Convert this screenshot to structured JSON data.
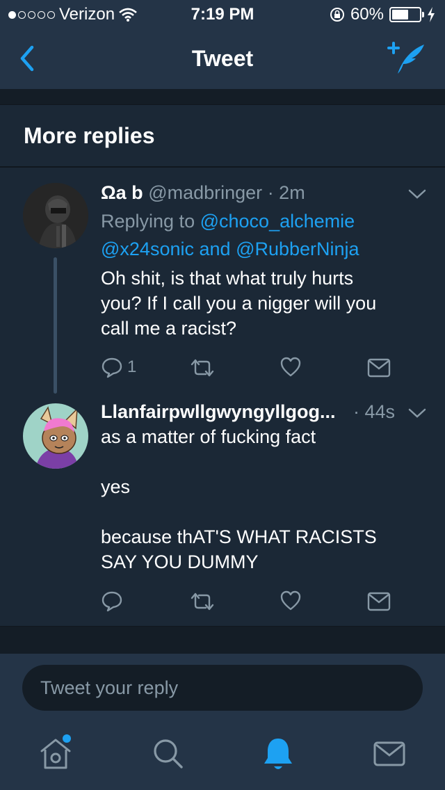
{
  "status_bar": {
    "carrier": "Verizon",
    "time": "7:19 PM",
    "battery": "60%",
    "battery_level": 0.6
  },
  "nav": {
    "title": "Tweet"
  },
  "section": {
    "title": "More replies"
  },
  "tweets": [
    {
      "display_name": "Ωa b",
      "handle": "@madbringer",
      "time": "· 2m",
      "replying_prefix": "Replying to",
      "replying_line1": "@choco_alchemie",
      "replying_mention2": "@x24sonic",
      "replying_and": "and",
      "replying_mention3": "@RubberNinja",
      "body_lines": [
        "Oh shit, is that what truly hurts",
        "you? If I call you a nigger will you",
        "call me a racist?"
      ],
      "reply_count": "1"
    },
    {
      "display_name": "Llanfairpwllgwyngyllgog...",
      "time": "· 44s",
      "body_lines": [
        "as a matter of fucking fact",
        "",
        "yes",
        "",
        "because thAT'S WHAT RACISTS",
        "SAY YOU DUMMY"
      ]
    }
  ],
  "reply_box": {
    "placeholder": "Tweet your reply"
  },
  "colors": {
    "accent": "#1da1f2",
    "background": "#1b2836",
    "bar": "#243447",
    "muted": "#8899a6"
  },
  "icons": [
    "back-chevron-icon",
    "compose-tweet-icon",
    "reply-icon",
    "retweet-icon",
    "like-icon",
    "direct-message-icon",
    "home-icon",
    "search-icon",
    "notifications-bell-icon",
    "messages-icon"
  ]
}
